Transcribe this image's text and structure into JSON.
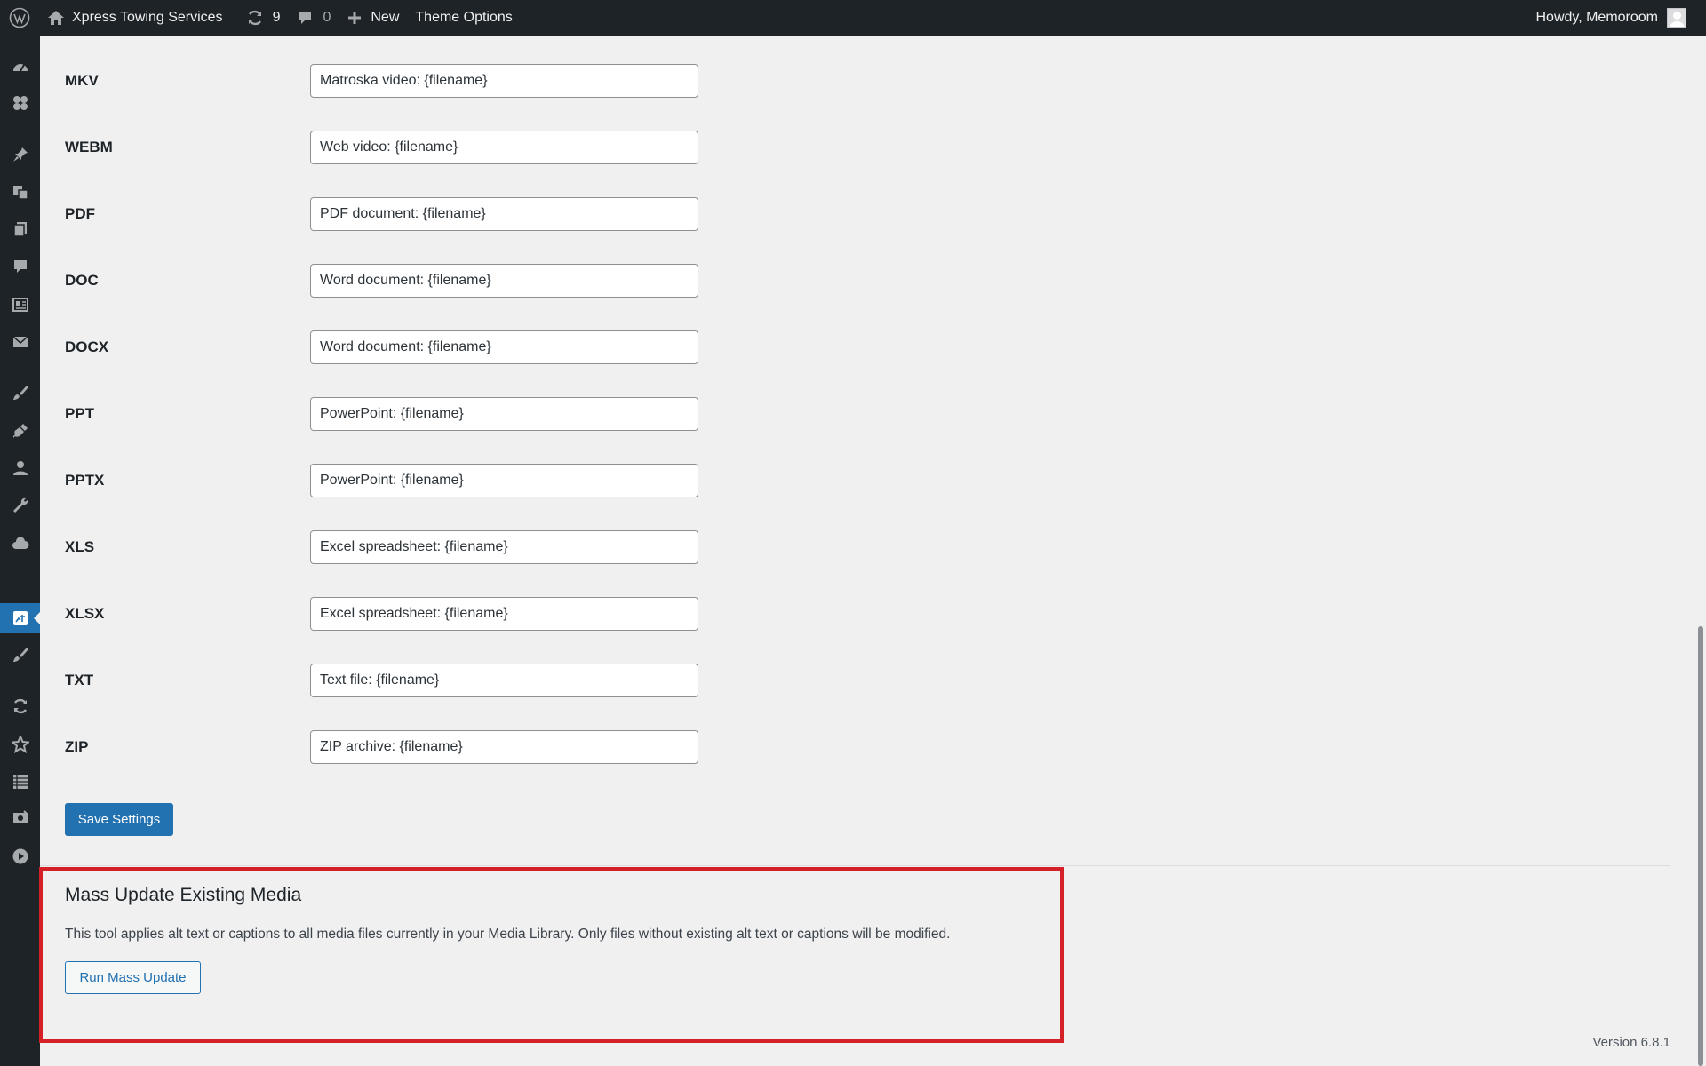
{
  "adminbar": {
    "site_name": "Xpress Towing Services",
    "updates_count": "9",
    "comments_count": "0",
    "new_label": "New",
    "theme_options_label": "Theme Options",
    "greeting": "Howdy, Memoroom"
  },
  "sidemenu": {
    "icons": [
      "dashboard-icon",
      "appearance-icon",
      "posts-icon",
      "media-icon",
      "pages-icon",
      "comments-icon",
      "portfolio-icon",
      "contact-icon",
      "appearance-brush-icon",
      "plugins-icon",
      "users-icon",
      "tools-icon",
      "cloud-icon",
      "media-text-settings-icon",
      "brush-icon",
      "sync-icon",
      "star-icon",
      "list-icon",
      "settings-icon",
      "play-icon"
    ]
  },
  "settings": {
    "rows": [
      {
        "label": "MKV",
        "value": "Matroska video: {filename}"
      },
      {
        "label": "WEBM",
        "value": "Web video: {filename}"
      },
      {
        "label": "PDF",
        "value": "PDF document: {filename}"
      },
      {
        "label": "DOC",
        "value": "Word document: {filename}"
      },
      {
        "label": "DOCX",
        "value": "Word document: {filename}"
      },
      {
        "label": "PPT",
        "value": "PowerPoint: {filename}"
      },
      {
        "label": "PPTX",
        "value": "PowerPoint: {filename}"
      },
      {
        "label": "XLS",
        "value": "Excel spreadsheet: {filename}"
      },
      {
        "label": "XLSX",
        "value": "Excel spreadsheet: {filename}"
      },
      {
        "label": "TXT",
        "value": "Text file: {filename}"
      },
      {
        "label": "ZIP",
        "value": "ZIP archive: {filename}"
      }
    ],
    "save_label": "Save Settings"
  },
  "mass_update": {
    "title": "Mass Update Existing Media",
    "description": "This tool applies alt text or captions to all media files currently in your Media Library. Only files without existing alt text or captions will be modified.",
    "button_label": "Run Mass Update"
  },
  "footer": {
    "version": "Version 6.8.1"
  },
  "colors": {
    "adminbar_bg": "#1d2327",
    "accent": "#2271b1",
    "highlight_border": "#d42027"
  }
}
